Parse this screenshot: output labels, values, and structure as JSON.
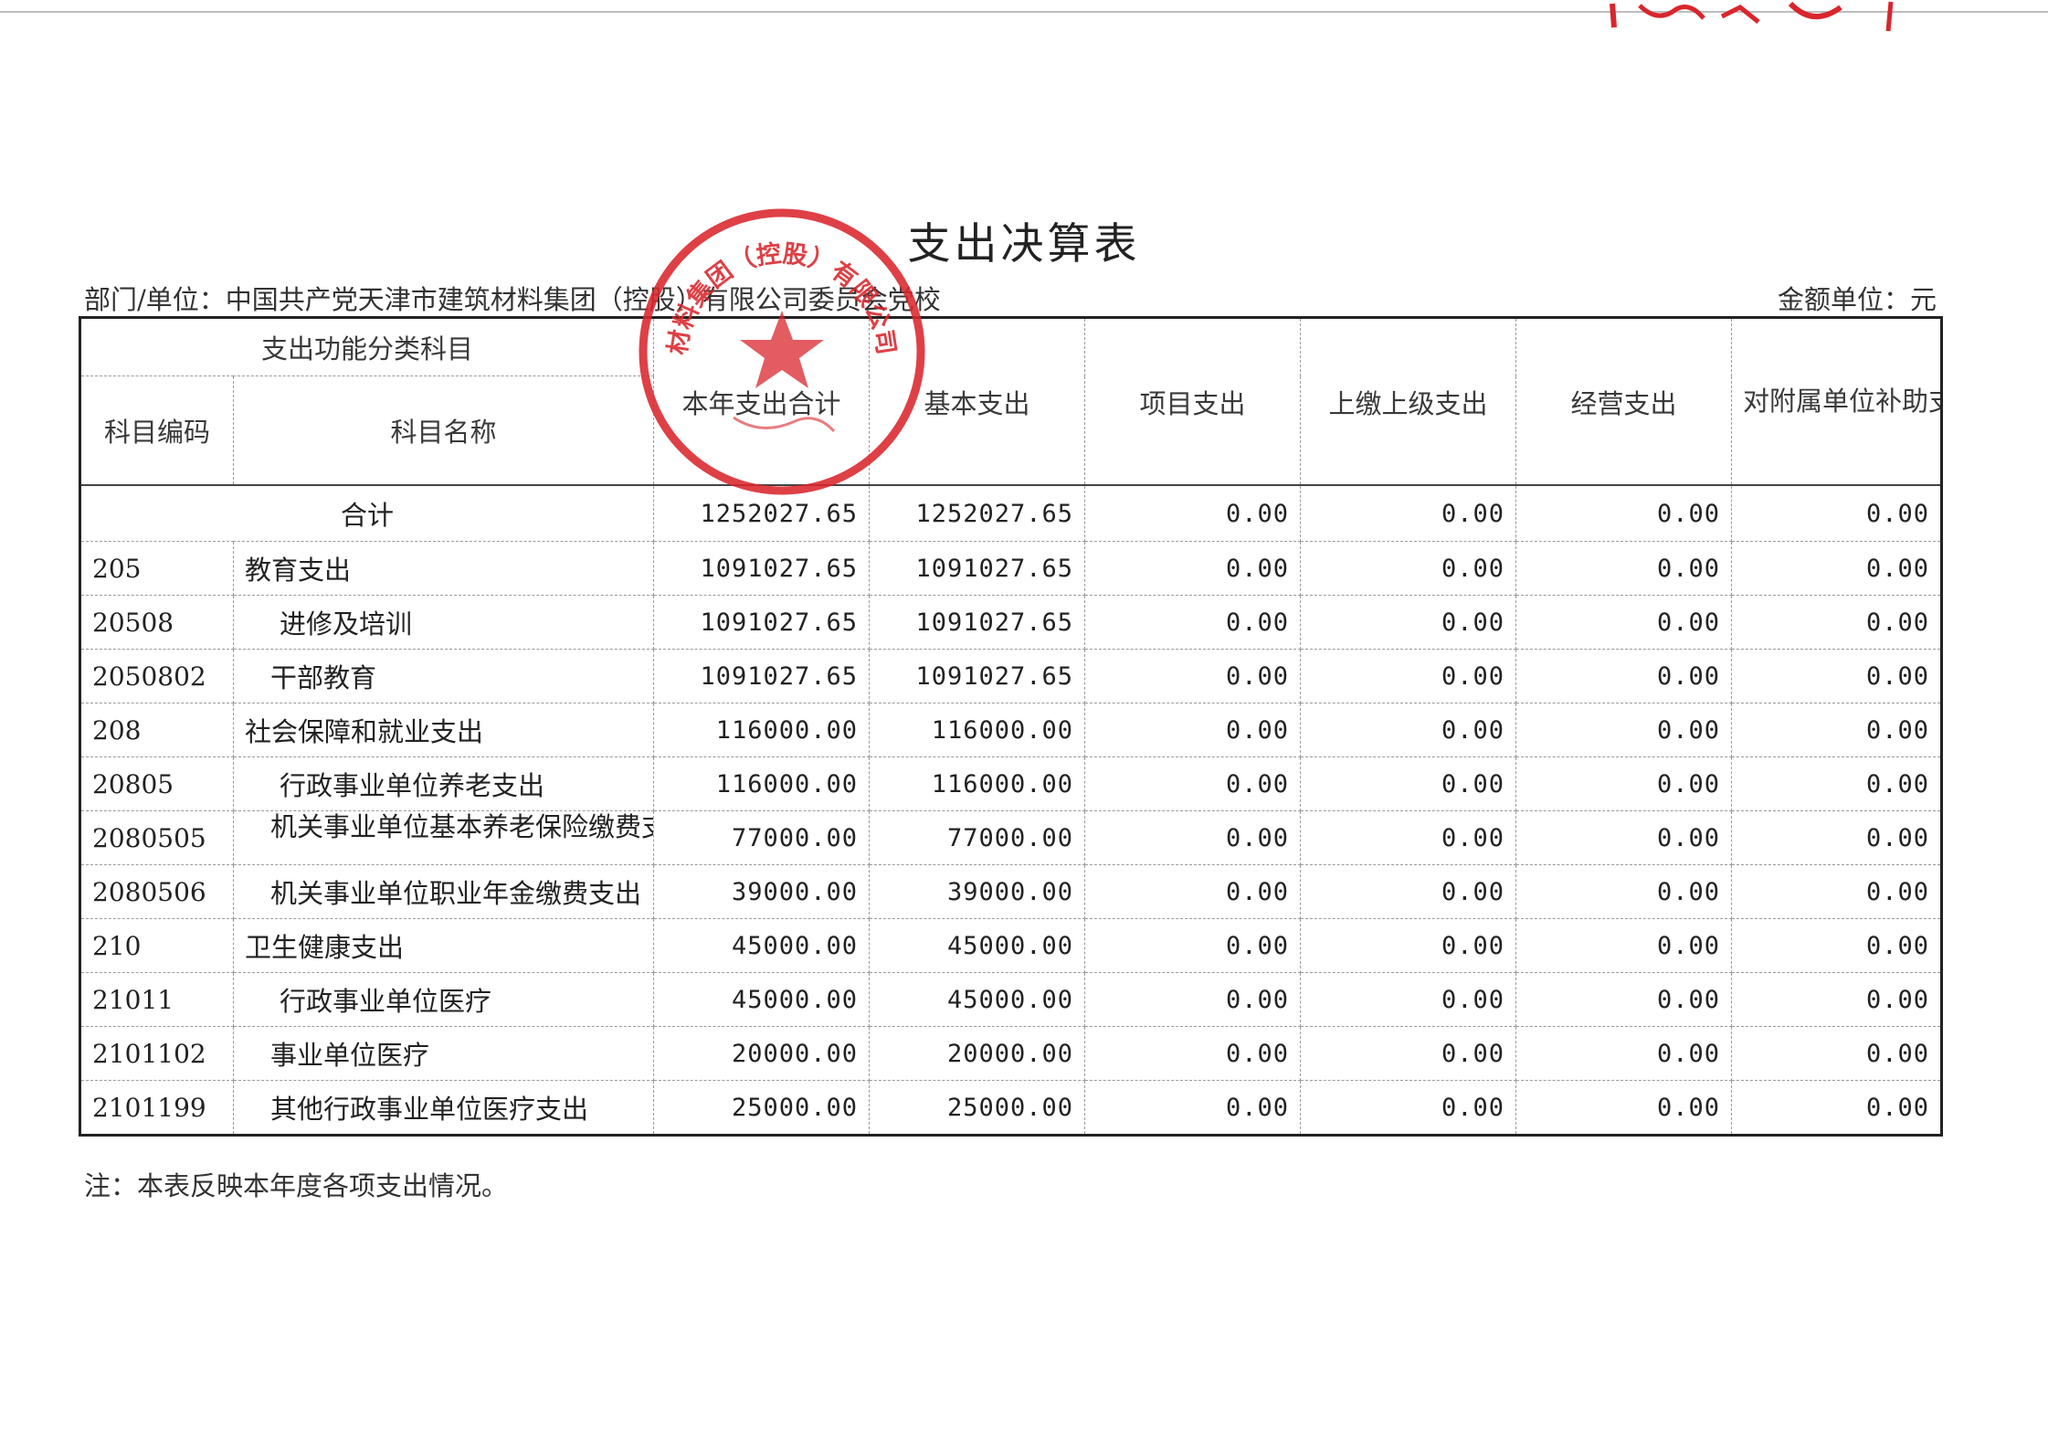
{
  "document": {
    "title": "支出决算表",
    "department_label": "部门/单位：中国共产党天津市建筑材料集团（控股）有限公司委员会党校",
    "unit_label": "金额单位：元",
    "note": "注：本表反映本年度各项支出情况。",
    "stamp_text": "天津市建筑材料集团（控股）有限公司委员会党校",
    "stamp_color": "#d9262c"
  },
  "table": {
    "group_header": "支出功能分类科目",
    "code_header": "科目编码",
    "name_header": "科目名称",
    "columns": [
      "本年支出合计",
      "基本支出",
      "项目支出",
      "上缴上级支出",
      "经营支出",
      "对附属单位补助支出"
    ],
    "total": {
      "label": "合计",
      "values": [
        "1252027.65",
        "1252027.65",
        "0.00",
        "0.00",
        "0.00",
        "0.00"
      ]
    },
    "rows": [
      {
        "code": "205",
        "name": "教育支出",
        "values": [
          "1091027.65",
          "1091027.65",
          "0.00",
          "0.00",
          "0.00",
          "0.00"
        ]
      },
      {
        "code": "20508",
        "name": "进修及培训",
        "values": [
          "1091027.65",
          "1091027.65",
          "0.00",
          "0.00",
          "0.00",
          "0.00"
        ]
      },
      {
        "code": "2050802",
        "name": "干部教育",
        "values": [
          "1091027.65",
          "1091027.65",
          "0.00",
          "0.00",
          "0.00",
          "0.00"
        ]
      },
      {
        "code": "208",
        "name": "社会保障和就业支出",
        "values": [
          "116000.00",
          "116000.00",
          "0.00",
          "0.00",
          "0.00",
          "0.00"
        ]
      },
      {
        "code": "20805",
        "name": "行政事业单位养老支出",
        "values": [
          "116000.00",
          "116000.00",
          "0.00",
          "0.00",
          "0.00",
          "0.00"
        ]
      },
      {
        "code": "2080505",
        "name": "机关事业单位基本养老保险缴费支出",
        "values": [
          "77000.00",
          "77000.00",
          "0.00",
          "0.00",
          "0.00",
          "0.00"
        ]
      },
      {
        "code": "2080506",
        "name": "机关事业单位职业年金缴费支出",
        "values": [
          "39000.00",
          "39000.00",
          "0.00",
          "0.00",
          "0.00",
          "0.00"
        ]
      },
      {
        "code": "210",
        "name": "卫生健康支出",
        "values": [
          "45000.00",
          "45000.00",
          "0.00",
          "0.00",
          "0.00",
          "0.00"
        ]
      },
      {
        "code": "21011",
        "name": "行政事业单位医疗",
        "values": [
          "45000.00",
          "45000.00",
          "0.00",
          "0.00",
          "0.00",
          "0.00"
        ]
      },
      {
        "code": "2101102",
        "name": "事业单位医疗",
        "values": [
          "20000.00",
          "20000.00",
          "0.00",
          "0.00",
          "0.00",
          "0.00"
        ]
      },
      {
        "code": "2101199",
        "name": "其他行政事业单位医疗支出",
        "values": [
          "25000.00",
          "25000.00",
          "0.00",
          "0.00",
          "0.00",
          "0.00"
        ]
      }
    ]
  }
}
